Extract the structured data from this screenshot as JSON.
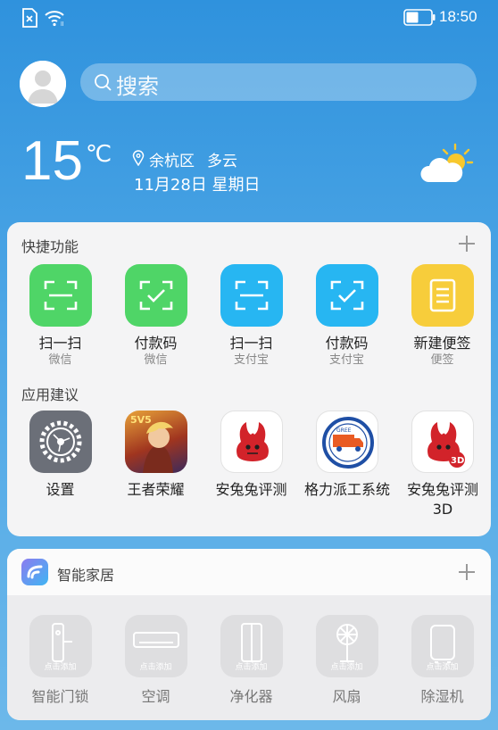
{
  "status_bar": {
    "time": "18:50"
  },
  "header": {
    "search_placeholder": "搜索"
  },
  "weather": {
    "temperature": "15",
    "unit": "℃",
    "location": "余杭区",
    "condition": "多云",
    "date": "11月28日 星期日"
  },
  "shortcuts": {
    "title": "快捷功能",
    "items": [
      {
        "label": "扫一扫",
        "sub": "微信",
        "icon": "scan-icon",
        "color": "#4fd567"
      },
      {
        "label": "付款码",
        "sub": "微信",
        "icon": "pay-code-icon",
        "color": "#4fd567"
      },
      {
        "label": "扫一扫",
        "sub": "支付宝",
        "icon": "scan-icon",
        "color": "#27b6f2"
      },
      {
        "label": "付款码",
        "sub": "支付宝",
        "icon": "pay-code-icon",
        "color": "#27b6f2"
      },
      {
        "label": "新建便签",
        "sub": "便签",
        "icon": "note-icon",
        "color": "#f7cd3b"
      }
    ]
  },
  "suggestions": {
    "title": "应用建议",
    "items": [
      {
        "label": "设置",
        "icon": "settings-gear-icon"
      },
      {
        "label": "王者荣耀",
        "icon": "game-hero-icon",
        "badge": "5V5"
      },
      {
        "label": "安兔兔评测",
        "icon": "antutu-icon"
      },
      {
        "label": "格力派工系统",
        "icon": "gree-truck-icon",
        "badge": "GREE"
      },
      {
        "label": "安兔兔评测3D",
        "icon": "antutu-3d-icon",
        "badge": "3D"
      }
    ]
  },
  "smart_home": {
    "title": "智能家居",
    "add_hint": "点击添加",
    "devices": [
      {
        "label": "智能门锁",
        "icon": "door-lock-icon"
      },
      {
        "label": "空调",
        "icon": "air-conditioner-icon"
      },
      {
        "label": "净化器",
        "icon": "air-purifier-icon"
      },
      {
        "label": "风扇",
        "icon": "fan-icon"
      },
      {
        "label": "除湿机",
        "icon": "dehumidifier-icon"
      }
    ]
  }
}
